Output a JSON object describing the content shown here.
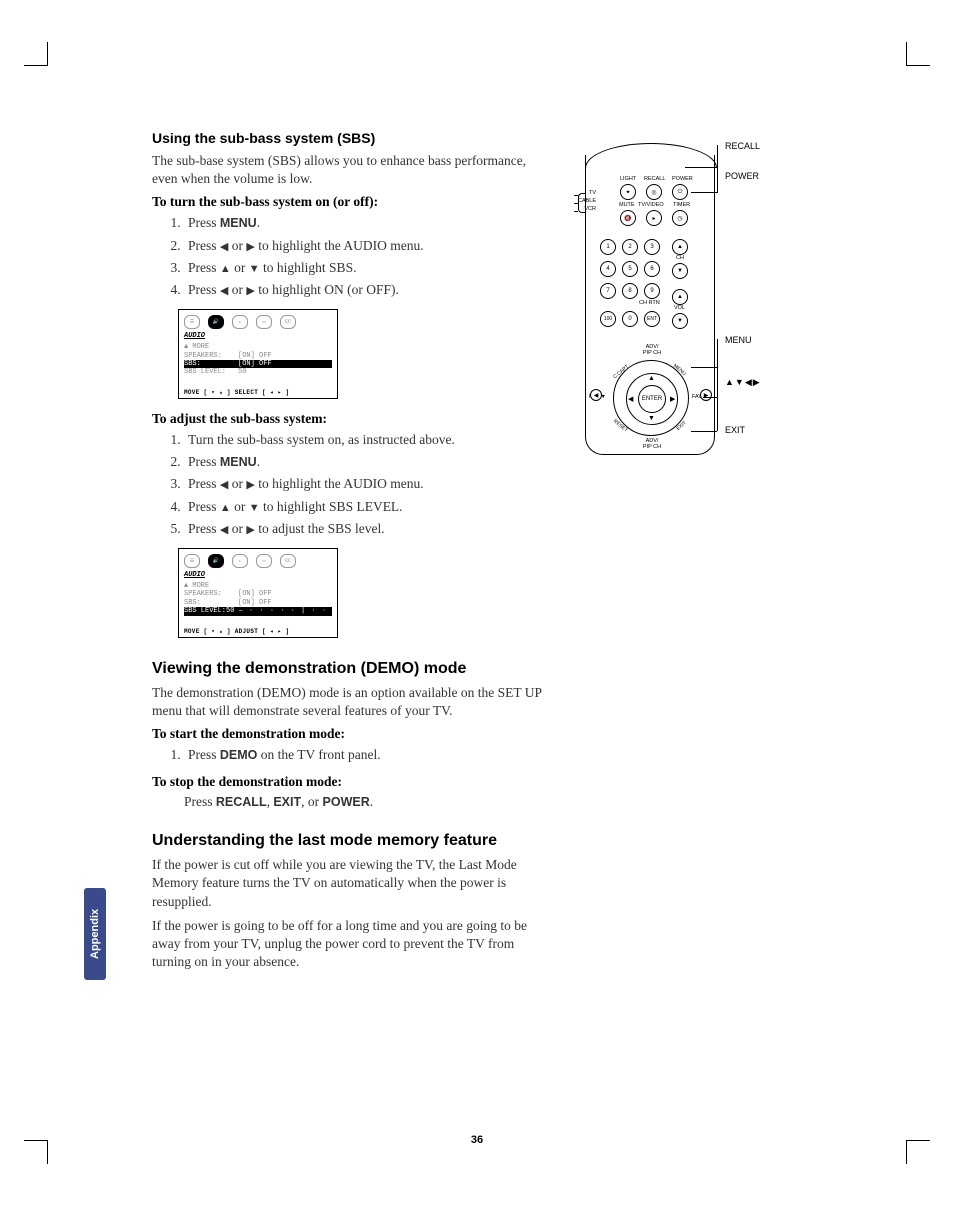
{
  "sideTab": "Appendix",
  "pageNumber": "36",
  "section1": {
    "title": "Using the sub-bass system (SBS)",
    "intro": "The sub-base system (SBS) allows you to enhance bass performance, even when the volume is low.",
    "procATitle": "To turn the sub-bass system on (or off):",
    "procA": {
      "s1a": "Press ",
      "s1b": "MENU",
      "s1c": ".",
      "s2a": "Press ",
      "s2b": " or ",
      "s2c": " to highlight the AUDIO menu.",
      "s3a": "Press ",
      "s3b": " or ",
      "s3c": " to highlight SBS.",
      "s4a": "Press ",
      "s4b": " or ",
      "s4c": " to highlight ON (or OFF)."
    },
    "procBTitle": "To adjust the sub-bass system:",
    "procB": {
      "s1": "Turn the sub-bass system on, as instructed above.",
      "s2a": "Press ",
      "s2b": "MENU",
      "s2c": ".",
      "s3a": "Press ",
      "s3b": " or ",
      "s3c": " to highlight the AUDIO menu.",
      "s4a": "Press ",
      "s4b": " or ",
      "s4c": " to highlight SBS LEVEL.",
      "s5a": "Press ",
      "s5b": " or ",
      "s5c": " to adjust the SBS level."
    }
  },
  "osd1": {
    "title": "AUDIO",
    "tabs": [
      "🖵",
      "🔊",
      "⫟",
      "▭",
      "CC"
    ],
    "more": "▲ MORE",
    "rows": [
      {
        "lbl": "SPEAKERS:",
        "val": "[ON] OFF"
      },
      {
        "lbl": "SBS:",
        "val": "[ON] OFF"
      },
      {
        "lbl": "SBS LEVEL:",
        "val": "50"
      }
    ],
    "hint": "MOVE [ ▾ ▴ ]    SELECT [ ◂ ▸ ]"
  },
  "osd2": {
    "title": "AUDIO",
    "more": "▲ MORE",
    "rows": [
      {
        "lbl": "SPEAKERS:",
        "val": "[ON] OFF"
      },
      {
        "lbl": "SBS:",
        "val": "[ON] OFF"
      },
      {
        "lbl": "SBS LEVEL:",
        "val": "50",
        "slider": "– ∙ ∙ ∙ ∙ ∙ | ∙ ∙ ∙ ∙ ∙ +"
      }
    ],
    "hint": "MOVE [ ▾ ▴ ]    ADJUST [ ◂ ▸ ]"
  },
  "section2": {
    "title": "Viewing the demonstration (DEMO) mode",
    "intro": "The demonstration (DEMO) mode is an option available on the SET UP menu that will demonstrate several features of your TV.",
    "procATitle": "To start the demonstration mode:",
    "s1a": "Press ",
    "s1b": "DEMO",
    "s1c": " on the TV front panel.",
    "procBTitle": "To stop the demonstration mode:",
    "pressLineA": "Press  ",
    "pressRecall": "RECALL",
    "pressComma": ", ",
    "pressExit": "EXIT",
    "pressOr": ", or ",
    "pressPower": "POWER",
    "pressDot": "."
  },
  "section3": {
    "title": "Understanding the last mode memory feature",
    "p1": "If the power is cut off while you are viewing the TV, the Last Mode Memory feature turns the TV on automatically when the power is resupplied.",
    "p2": "If the power is going to be off for a long time and you are going to be away from your TV, unplug the power cord to prevent the TV from turning on in your absence."
  },
  "remote": {
    "topLabels": {
      "light": "LIGHT",
      "recall": "RECALL",
      "power": "POWER",
      "mute": "MUTE",
      "tvvideo": "TV/VIDEO",
      "timer": "TIMER"
    },
    "switch": {
      "tv": "TV",
      "cable": "CABLE",
      "vcr": "VCR"
    },
    "keypad": [
      "1",
      "2",
      "3",
      "4",
      "5",
      "6",
      "7",
      "8",
      "9",
      "100",
      "0",
      "ENT"
    ],
    "chRtn": "CH RTN",
    "ch": "CH",
    "vol": "VOL",
    "nav": {
      "enter": "ENTER",
      "menu": "MENU",
      "exit": "EXIT",
      "ccapt": "C.CAPT",
      "reset": "RESET",
      "advpip": "ADV/\nPIP CH",
      "favUp": "FAV ▲",
      "favDn": "FAV ▼"
    },
    "callouts": {
      "recall": "RECALL",
      "power": "POWER",
      "menu": "MENU",
      "arrows": "▲▼◀▶",
      "exit": "EXIT"
    }
  }
}
